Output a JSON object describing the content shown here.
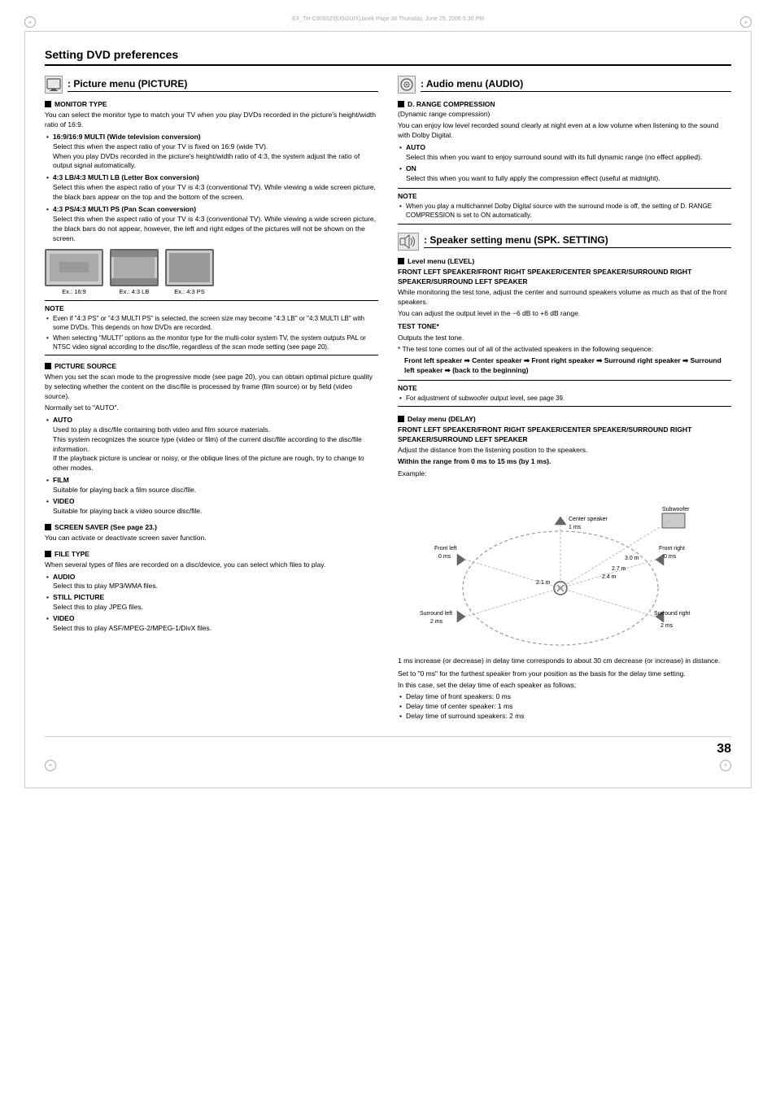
{
  "page": {
    "title": "Setting DVD preferences",
    "page_number": "38",
    "header_text": "EX_TH-C906020[USGU/X].book  Page 38  Thursday, June 29, 2006  5:30 PM"
  },
  "left_column": {
    "picture_section": {
      "icon": "▦",
      "title": ": Picture menu (PICTURE)",
      "monitor_type": {
        "title": "MONITOR TYPE",
        "intro": "You can select the monitor type to match your TV when you play DVDs recorded in the picture's height/width ratio of 16:9.",
        "options": [
          {
            "label": "16:9/16:9 MULTI (Wide television conversion)",
            "description": "Select this when the aspect ratio of your TV is fixed on 16:9 (wide TV).\nWhen you play DVDs recorded in the picture's height/width ratio of 4:3, the system adjust the ratio of output signal automatically."
          },
          {
            "label": "4:3 LB/4:3 MULTI LB (Letter Box conversion)",
            "description": "Select this when the aspect ratio of your TV is 4:3 (conventional TV). While viewing a wide screen picture, the black bars appear on the top and the bottom of the screen."
          },
          {
            "label": "4:3 PS/4:3 MULTI PS (Pan Scan conversion)",
            "description": "Select this when the aspect ratio of your TV is 4:3 (conventional TV). While viewing a wide screen picture, the black bars do not appear, however, the left and right edges of the pictures will not be shown on the screen."
          }
        ],
        "image_labels": [
          "Ex.: 16:9",
          "Ex.: 4:3 LB",
          "Ex.: 4:3 PS"
        ],
        "notes": [
          "Even if \"4:3 PS\" or \"4:3 MULTI PS\" is selected, the screen size may become \"4:3 LB\" or \"4:3 MULTI LB\" with some DVDs. This depends on how DVDs are recorded.",
          "When selecting \"MULTI\" options as the monitor type for the multi-color system TV, the system outputs PAL or NTSC video signal according to the disc/file, regardless of the scan mode setting (see page 20)."
        ]
      },
      "picture_source": {
        "title": "PICTURE SOURCE",
        "intro": "When you set the scan mode to the progressive mode (see page 20), you can obtain optimal picture quality by selecting whether the content on the disc/file is processed by frame (film source) or by field (video source).",
        "normally": "Normally set to \"AUTO\".",
        "options": [
          {
            "label": "AUTO",
            "description": "Used to play a disc/file containing both video and film source materials.\nThis system recognizes the source type (video or film) of the current disc/file according to the disc/file information.\nIf the playback picture is unclear or noisy, or the oblique lines of the picture are rough, try to change to other modes."
          },
          {
            "label": "FILM",
            "description": "Suitable for playing back a film source disc/file."
          },
          {
            "label": "VIDEO",
            "description": "Suitable for playing back a video source disc/file."
          }
        ]
      },
      "screen_saver": {
        "title": "SCREEN SAVER (See page 23.)",
        "description": "You can activate or deactivate screen saver function."
      },
      "file_type": {
        "title": "FILE TYPE",
        "intro": "When several types of files are recorded on a disc/device, you can select which files to play.",
        "options": [
          {
            "label": "AUDIO",
            "description": "Select this to play MP3/WMA files."
          },
          {
            "label": "STILL PICTURE",
            "description": "Select this to play JPEG files."
          },
          {
            "label": "VIDEO",
            "description": "Select this to play ASF/MPEG-2/MPEG-1/DivX files."
          }
        ]
      }
    }
  },
  "right_column": {
    "audio_section": {
      "icon": "♪",
      "title": ": Audio menu (AUDIO)",
      "d_range": {
        "title": "D. RANGE COMPRESSION",
        "subtitle": "(Dynamic range compression)",
        "intro": "You can enjoy low level recorded sound clearly at night even at a low volume when listening to the sound with Dolby Digital.",
        "options": [
          {
            "label": "AUTO",
            "description": "Select this when you want to enjoy surround sound with its full dynamic range (no effect applied)."
          },
          {
            "label": "ON",
            "description": "Select this when you want to fully apply the compression effect (useful at midnight)."
          }
        ],
        "note": "When you play a multichannel Dolby Digital source with the surround mode is off, the setting of D. RANGE COMPRESSION is set to ON automatically."
      }
    },
    "speaker_section": {
      "icon": "🔊",
      "title": ": Speaker setting menu (SPK. SETTING)",
      "level_menu": {
        "title": "Level menu (LEVEL)",
        "speakers_title": "FRONT LEFT SPEAKER/FRONT RIGHT SPEAKER/CENTER SPEAKER/SURROUND RIGHT SPEAKER/SURROUND LEFT SPEAKER",
        "description": "While monitoring the test tone, adjust the center and surround speakers volume as much as that of the front speakers.",
        "range": "You can adjust the output level in the −6 dB to +6 dB range.",
        "test_tone_title": "TEST TONE*",
        "test_tone_desc": "Outputs the test tone.",
        "asterisk_note": "The test tone comes out of all of the activated speakers in the following sequence:",
        "sequence": "Front left speaker ➡ Center speaker ➡ Front right speaker ➡ Surround right speaker ➡ Surround left speaker ➡ (back to the beginning)",
        "note": "For adjustment of subwoofer output level, see page 39."
      },
      "delay_menu": {
        "title": "Delay menu (DELAY)",
        "speakers_title": "FRONT LEFT SPEAKER/FRONT RIGHT SPEAKER/CENTER SPEAKER/SURROUND RIGHT SPEAKER/SURROUND LEFT SPEAKER",
        "description": "Adjust the distance from the listening position to the speakers.",
        "range": "Within the range from 0 ms to 15 ms (by 1 ms).",
        "example_label": "Example:",
        "diagram_labels": {
          "center_speaker": "Center speaker",
          "center_ms": "1 ms",
          "subwoofer": "Subwoofer",
          "front_left": "Front left",
          "front_left_ms": "0 ms",
          "front_right": "Front right",
          "front_right_ms": "0 ms",
          "dist1": "3.0 m",
          "dist2": "2.7 m",
          "dist3": "2.4 m",
          "surround_left": "Surround left",
          "surround_left_ms": "2 ms",
          "surround_right": "Surround right",
          "surround_right_ms": "2 ms",
          "center_dist": "2.1 m"
        },
        "note_1ms": "1 ms increase (or decrease) in delay time corresponds to about 30 cm decrease (or increase) in distance.",
        "set_note": "Set to \"0 ms\" for the furthest speaker from your position as the basis for the delay time setting.",
        "in_this_case": "In this case, set the delay time of each speaker as follows;",
        "delay_times": [
          "Delay time of front speakers: 0 ms",
          "Delay time of center speaker: 1 ms",
          "Delay time of surround speakers: 2 ms"
        ]
      }
    }
  }
}
